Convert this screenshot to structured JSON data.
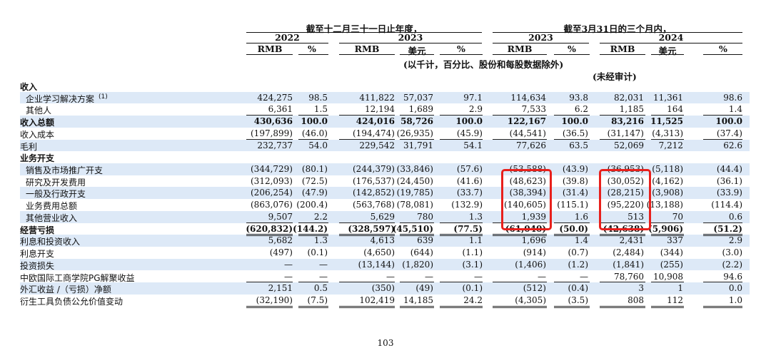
{
  "header": {
    "fy_group": "截至十二月三十一日止年度，",
    "q_group": "截至3月31日的三个月内，",
    "years": [
      "2022",
      "2023",
      "2023",
      "2024"
    ],
    "currency_labels": [
      "RMB",
      "%",
      "RMB",
      "美元",
      "%",
      "RMB",
      "%",
      "RMB",
      "美元",
      "%"
    ],
    "unit_note": "(以千计，百分比、股份和每股数据除外)",
    "unaudited": "(未经审计)"
  },
  "rows": [
    {
      "label": "收入",
      "values": [
        "",
        "",
        "",
        "",
        "",
        "",
        "",
        "",
        "",
        ""
      ]
    },
    {
      "label": "企业学习解决方案",
      "sup": "(1)",
      "values": [
        "424,275",
        "98.5",
        "411,822",
        "57,037",
        "97.1",
        "114,634",
        "93.8",
        "82,031",
        "11,361",
        "98.6"
      ]
    },
    {
      "label": "其他人",
      "values": [
        "6,361",
        "1.5",
        "12,194",
        "1,689",
        "2.9",
        "7,533",
        "6.2",
        "1,185",
        "164",
        "1.4"
      ]
    },
    {
      "label": "收入总额",
      "values": [
        "430,636",
        "100.0",
        "424,016",
        "58,726",
        "100.0",
        "122,167",
        "100.0",
        "83,216",
        "11,525",
        "100.0"
      ]
    },
    {
      "label": "收入成本",
      "values": [
        "(197,899)",
        "(46.0)",
        "(194,474)",
        "(26,935)",
        "(45.9)",
        "(44,541)",
        "(36.5)",
        "(31,147)",
        "(4,313)",
        "(37.4)"
      ]
    },
    {
      "label": "毛利",
      "values": [
        "232,737",
        "54.0",
        "229,542",
        "31,791",
        "54.1",
        "77,626",
        "63.5",
        "52,069",
        "7,212",
        "62.6"
      ]
    },
    {
      "label": "业务开支",
      "values": [
        "",
        "",
        "",
        "",
        "",
        "",
        "",
        "",
        "",
        ""
      ]
    },
    {
      "label": "销售及市场推广开支",
      "values": [
        "(344,729)",
        "(80.1)",
        "(244,379)",
        "(33,846)",
        "(57.6)",
        "(53,588)",
        "(43.9)",
        "(36,953)",
        "(5,118)",
        "(44.4)"
      ]
    },
    {
      "label": "研究及开发费用",
      "values": [
        "(312,093)",
        "(72.5)",
        "(176,537)",
        "(24,450)",
        "(41.6)",
        "(48,623)",
        "(39.8)",
        "(30,052)",
        "(4,162)",
        "(36.1)"
      ]
    },
    {
      "label": "一般及行政开支",
      "values": [
        "(206,254)",
        "(47.9)",
        "(142,852)",
        "(19,785)",
        "(33.7)",
        "(38,394)",
        "(31.4)",
        "(28,215)",
        "(3,908)",
        "(33.9)"
      ]
    },
    {
      "label": "业务费用总额",
      "values": [
        "(863,076)",
        "(200.4)",
        "(563,768)",
        "(78,081)",
        "(132.9)",
        "(140,605)",
        "(115.1)",
        "(95,220)",
        "(13,188)",
        "(114.4)"
      ]
    },
    {
      "label": "其他营业收入",
      "values": [
        "9,507",
        "2.2",
        "5,629",
        "780",
        "1.3",
        "1,939",
        "1.6",
        "513",
        "70",
        "0.6"
      ]
    },
    {
      "label": "经营亏损",
      "values": [
        "(620,832)",
        "(144.2)",
        "(328,597)",
        "(45,510)",
        "(77.5)",
        "(61,040)",
        "(50.0)",
        "(42,638)",
        "(5,906)",
        "(51.2)"
      ]
    },
    {
      "label": "利息和投资收入",
      "values": [
        "5,682",
        "1.3",
        "4,613",
        "639",
        "1.1",
        "1,696",
        "1.4",
        "2,431",
        "337",
        "2.9"
      ]
    },
    {
      "label": "利息开支",
      "values": [
        "(497)",
        "(0.1)",
        "(4,650)",
        "(644)",
        "(1.1)",
        "(914)",
        "(0.7)",
        "(2,484)",
        "(344)",
        "(3.0)"
      ]
    },
    {
      "label": "投资损失",
      "values": [
        "—",
        "—",
        "(13,144)",
        "(1,820)",
        "(3.1)",
        "(1,406)",
        "(1.2)",
        "(1,841)",
        "(255)",
        "(2.2)"
      ]
    },
    {
      "label": "中欧国际工商学院PG解聚收益",
      "values": [
        "—",
        "—",
        "—",
        "—",
        "—",
        "—",
        "—",
        "78,760",
        "10,908",
        "94.6"
      ]
    },
    {
      "label": "外汇收益 /（亏损）净额",
      "values": [
        "2,151",
        "0.5",
        "(350)",
        "(49)",
        "(0.1)",
        "(512)",
        "(0.4)",
        "3",
        "1",
        "0.0"
      ]
    },
    {
      "label": "衍生工具负债公允价值变动",
      "values": [
        "(32,190)",
        "(7.5)",
        "102,419",
        "14,185",
        "24.2",
        "(4,305)",
        "(3.5)",
        "808",
        "112",
        "1.0"
      ]
    }
  ],
  "page_number": "103",
  "highlight_color": "#e8201c",
  "row_shade_color": "#dde9f7"
}
